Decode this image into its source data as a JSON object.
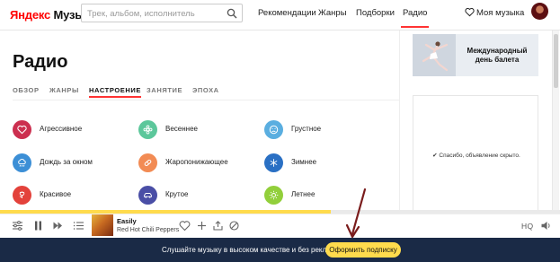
{
  "header": {
    "logo_ya": "Яндекс",
    "logo_music": "Музыка",
    "search_placeholder": "Трек, альбом, исполнитель",
    "nav": [
      {
        "label": "Рекомендации"
      },
      {
        "label": "Жанры"
      },
      {
        "label": "Подборки"
      },
      {
        "label": "Радио",
        "active": true
      }
    ],
    "my_music": "Моя музыка"
  },
  "main": {
    "title": "Радио",
    "tabs": [
      {
        "label": "ОБЗОР"
      },
      {
        "label": "ЖАНРЫ"
      },
      {
        "label": "НАСТРОЕНИЕ",
        "active": true
      },
      {
        "label": "ЗАНЯТИЕ"
      },
      {
        "label": "ЭПОХА"
      }
    ],
    "moods": [
      {
        "label": "Агрессивное",
        "color": "#cc2f4f",
        "icon": "heart-icon"
      },
      {
        "label": "Весеннее",
        "color": "#5cc79b",
        "icon": "flower-icon"
      },
      {
        "label": "Грустное",
        "color": "#5aaee0",
        "icon": "sad-face-icon"
      },
      {
        "label": "Дождь за окном",
        "color": "#3c8fd6",
        "icon": "cloud-rain-icon"
      },
      {
        "label": "Жаропонижающее",
        "color": "#f28b54",
        "icon": "pill-icon"
      },
      {
        "label": "Зимнее",
        "color": "#2a70c4",
        "icon": "snowflake-icon"
      },
      {
        "label": "Красивое",
        "color": "#e3423b",
        "icon": "flower-bloom-icon"
      },
      {
        "label": "Крутое",
        "color": "#4a4ea6",
        "icon": "car-icon"
      },
      {
        "label": "Летнее",
        "color": "#92cf3b",
        "icon": "sun-icon"
      }
    ]
  },
  "sidebar": {
    "ad_title": "Международный день балета",
    "hidden_message": "✔ Спасибо, объявление скрыто."
  },
  "player": {
    "track_title": "Easily",
    "track_artist": "Red Hot Chili Peppers",
    "quality_label": "HQ",
    "progress": 0.59
  },
  "subscription": {
    "text": "Слушайте музыку в высоком качестве и без рекламы",
    "button_label": "Оформить подписку",
    "button_color": "#ffdb4d",
    "bar_color": "#1a2a46"
  },
  "accent_color": "#ff3333",
  "annotation_arrow_color": "#7a1c1c"
}
